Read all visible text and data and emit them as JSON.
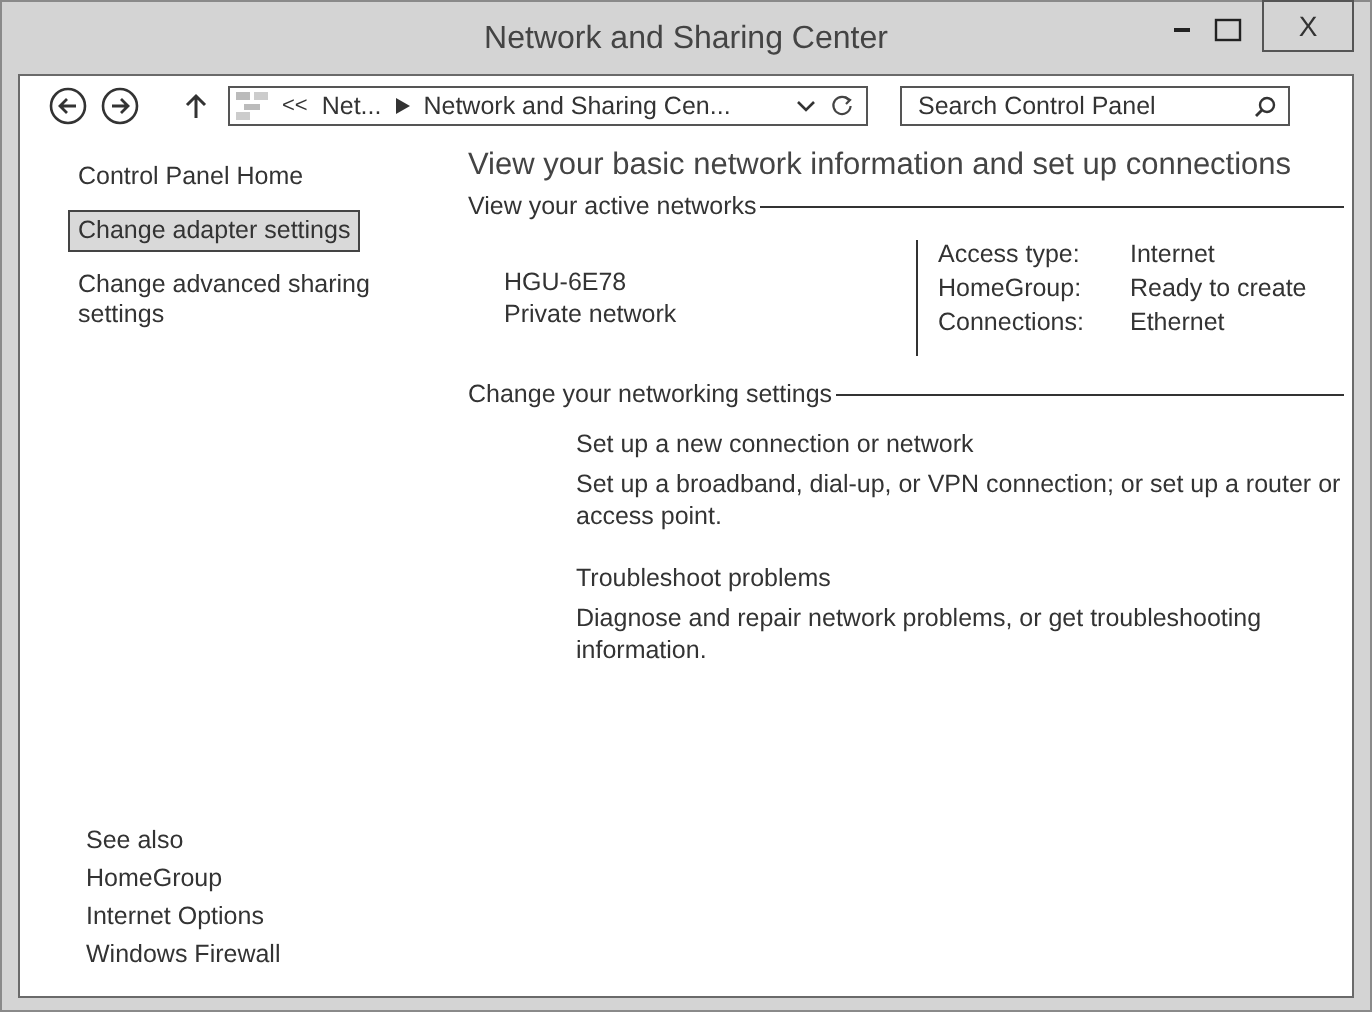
{
  "window": {
    "title": "Network and Sharing Center",
    "close_label": "X"
  },
  "address_bar": {
    "overflow": "<<",
    "crumbs": [
      "Net...",
      "Network and Sharing Cen..."
    ]
  },
  "search": {
    "placeholder": "Search Control Panel"
  },
  "sidebar": {
    "items": [
      {
        "label": "Control Panel Home",
        "selected": false
      },
      {
        "label": "Change adapter settings",
        "selected": true
      },
      {
        "label": "Change advanced sharing settings",
        "selected": false
      }
    ],
    "see_also": {
      "heading": "See also",
      "links": [
        "HomeGroup",
        "Internet Options",
        "Windows Firewall"
      ]
    }
  },
  "main": {
    "title": "View your basic network information and set up connections",
    "active_networks": {
      "heading": "View your active networks",
      "name": "HGU-6E78",
      "category": "Private network",
      "details": [
        {
          "label": "Access type:",
          "value": "Internet"
        },
        {
          "label": "HomeGroup:",
          "value": "Ready to create"
        },
        {
          "label": "Connections:",
          "value": "Ethernet"
        }
      ]
    },
    "settings": {
      "heading": "Change your networking settings",
      "tasks": [
        {
          "title": "Set up a new connection or network",
          "description": "Set up a broadband, dial-up, or VPN connection; or set up a router or access point."
        },
        {
          "title": "Troubleshoot problems",
          "description": "Diagnose and repair network problems, or get troubleshooting information."
        }
      ]
    }
  }
}
